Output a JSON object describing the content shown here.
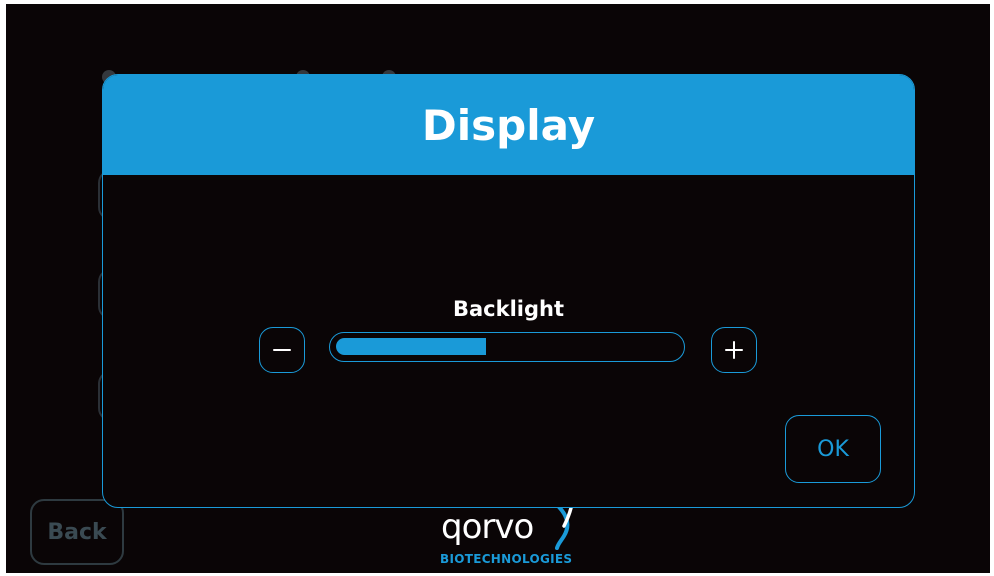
{
  "dialog": {
    "title": "Display",
    "setting_label": "Backlight",
    "backlight_level_fraction": 0.44,
    "decrease_icon": "minus-icon",
    "increase_icon": "plus-icon",
    "ok_label": "OK"
  },
  "footer": {
    "back_label": "Back",
    "logo_text": "qorvo",
    "logo_subtext": "BIOTECHNOLOGIES"
  },
  "colors": {
    "accent": "#1a9ad8",
    "background": "#0a0506",
    "text": "#ffffff",
    "disabled": "#3a4a52"
  }
}
